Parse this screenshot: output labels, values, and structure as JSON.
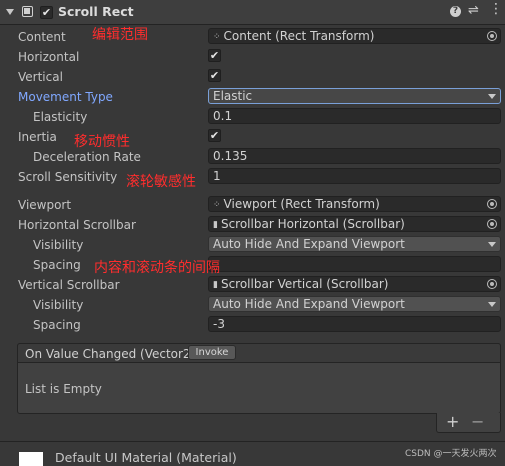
{
  "header": {
    "title": "Scroll Rect",
    "icons": [
      "chevron-down-icon",
      "component-icon",
      "enable-checkbox",
      "help-icon",
      "preset-icon",
      "more-icon"
    ]
  },
  "fields": {
    "content": {
      "label": "Content",
      "value": "Content (Rect Transform)"
    },
    "horizontal": {
      "label": "Horizontal",
      "checked": true
    },
    "vertical": {
      "label": "Vertical",
      "checked": true
    },
    "movement_type": {
      "label": "Movement Type",
      "value": "Elastic"
    },
    "elasticity": {
      "label": "Elasticity",
      "value": "0.1"
    },
    "inertia": {
      "label": "Inertia",
      "checked": true
    },
    "deceleration_rate": {
      "label": "Deceleration Rate",
      "value": "0.135"
    },
    "scroll_sensitivity": {
      "label": "Scroll Sensitivity",
      "value": "1"
    },
    "viewport": {
      "label": "Viewport",
      "value": "Viewport (Rect Transform)"
    },
    "horizontal_scrollbar": {
      "label": "Horizontal Scrollbar",
      "value": "Scrollbar Horizontal (Scrollbar)"
    },
    "h_visibility": {
      "label": "Visibility",
      "value": "Auto Hide And Expand Viewport"
    },
    "h_spacing": {
      "label": "Spacing",
      "value": ""
    },
    "vertical_scrollbar": {
      "label": "Vertical Scrollbar",
      "value": "Scrollbar Vertical (Scrollbar)"
    },
    "v_visibility": {
      "label": "Visibility",
      "value": "Auto Hide And Expand Viewport"
    },
    "v_spacing": {
      "label": "Spacing",
      "value": "-3"
    }
  },
  "annotations": {
    "content": "编辑范围",
    "inertia": "移动惯性",
    "scroll_sensitivity": "滚轮敏感性",
    "spacing": "内容和滚动条的间隔"
  },
  "event": {
    "title": "On Value Changed (Vector2)",
    "invoke_label": "Invoke",
    "empty_text": "List is Empty",
    "add_label": "+",
    "remove_label": "−"
  },
  "material": {
    "label": "Default UI Material (Material)"
  },
  "watermark": "CSDN @一天发火两次",
  "colors": {
    "highlight_label": "#80a8ff",
    "annotation": "#ff2d2d"
  }
}
